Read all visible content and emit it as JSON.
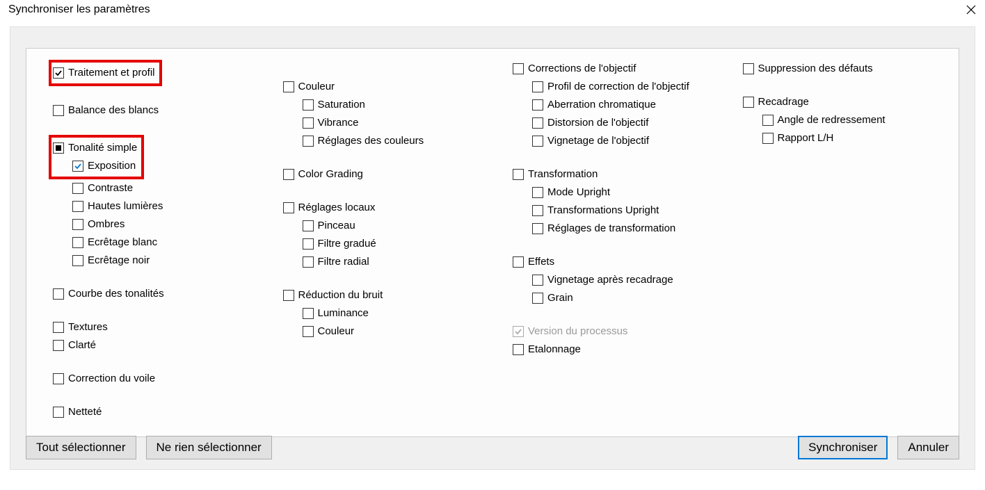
{
  "title": "Synchroniser les paramètres",
  "col1": {
    "traitement": "Traitement et profil",
    "balance": "Balance des blancs",
    "tonalite": "Tonalité simple",
    "exposition": "Exposition",
    "contraste": "Contraste",
    "hautes": "Hautes lumières",
    "ombres": "Ombres",
    "ecretage_blanc": "Ecrêtage blanc",
    "ecretage_noir": "Ecrêtage noir",
    "courbe": "Courbe des tonalités",
    "textures": "Textures",
    "clarte": "Clarté",
    "voile": "Correction du voile",
    "nettete": "Netteté"
  },
  "col2": {
    "couleur": "Couleur",
    "saturation": "Saturation",
    "vibrance": "Vibrance",
    "reglages_couleurs": "Réglages des couleurs",
    "color_grading": "Color Grading",
    "reglages_locaux": "Réglages locaux",
    "pinceau": "Pinceau",
    "filtre_gradue": "Filtre gradué",
    "filtre_radial": "Filtre radial",
    "reduction_bruit": "Réduction du bruit",
    "luminance": "Luminance",
    "couleur2": "Couleur"
  },
  "col3": {
    "corrections_objectif": "Corrections de l'objectif",
    "profil_correction": "Profil de correction de l'objectif",
    "aberration": "Aberration chromatique",
    "distorsion": "Distorsion de l'objectif",
    "vignetage_obj": "Vignetage de l'objectif",
    "transformation": "Transformation",
    "mode_upright": "Mode Upright",
    "transformations_upright": "Transformations Upright",
    "reglages_transformation": "Réglages de transformation",
    "effets": "Effets",
    "vignetage_recadrage": "Vignetage après recadrage",
    "grain": "Grain",
    "version_processus": "Version du processus",
    "etalonnage": "Etalonnage"
  },
  "col4": {
    "suppression_defauts": "Suppression des défauts",
    "recadrage": "Recadrage",
    "angle": "Angle de redressement",
    "rapport": "Rapport L/H"
  },
  "buttons": {
    "select_all": "Tout sélectionner",
    "select_none": "Ne rien sélectionner",
    "sync": "Synchroniser",
    "cancel": "Annuler"
  }
}
